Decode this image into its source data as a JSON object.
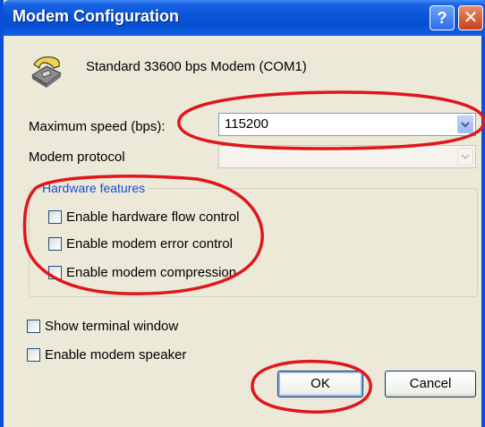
{
  "window": {
    "title": "Modem Configuration",
    "help_glyph": "?",
    "close_glyph": "✕"
  },
  "modem": {
    "name": "Standard 33600 bps Modem (COM1)",
    "icon": "telephone-modem-icon"
  },
  "max_speed": {
    "label": "Maximum speed (bps):",
    "value": "115200"
  },
  "protocol": {
    "label": "Modem protocol",
    "value": ""
  },
  "hardware": {
    "title": "Hardware features",
    "options": [
      {
        "label": "Enable hardware flow control",
        "checked": false
      },
      {
        "label": "Enable modem error control",
        "checked": false
      },
      {
        "label": "Enable modem compression",
        "checked": false
      }
    ]
  },
  "options": [
    {
      "label": "Show terminal window",
      "checked": false
    },
    {
      "label": "Enable modem speaker",
      "checked": false
    }
  ],
  "buttons": {
    "ok": "OK",
    "cancel": "Cancel"
  },
  "colors": {
    "titlebar": "#0a55d8",
    "dialog_bg": "#ece9d8",
    "annotation_red": "#e0161b",
    "group_title": "#1b4bd6"
  }
}
